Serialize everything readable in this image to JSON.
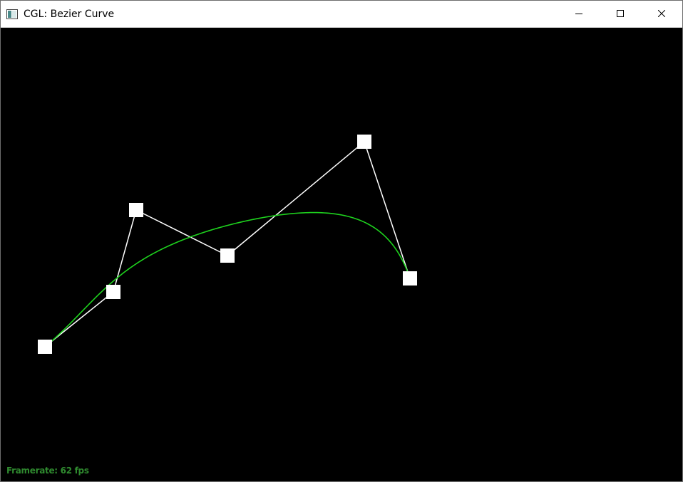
{
  "window": {
    "title": "CGL: Bezier Curve"
  },
  "icons": {
    "app": "app-window-icon",
    "minimize": "minimize-icon",
    "maximize": "maximize-icon",
    "close": "close-icon"
  },
  "colors": {
    "background": "#000000",
    "control_polygon": "#ffffff",
    "curve": "#1ed21e",
    "framerate_text": "#2f8a2f"
  },
  "status": {
    "framerate": "Framerate: 62 fps"
  }
}
